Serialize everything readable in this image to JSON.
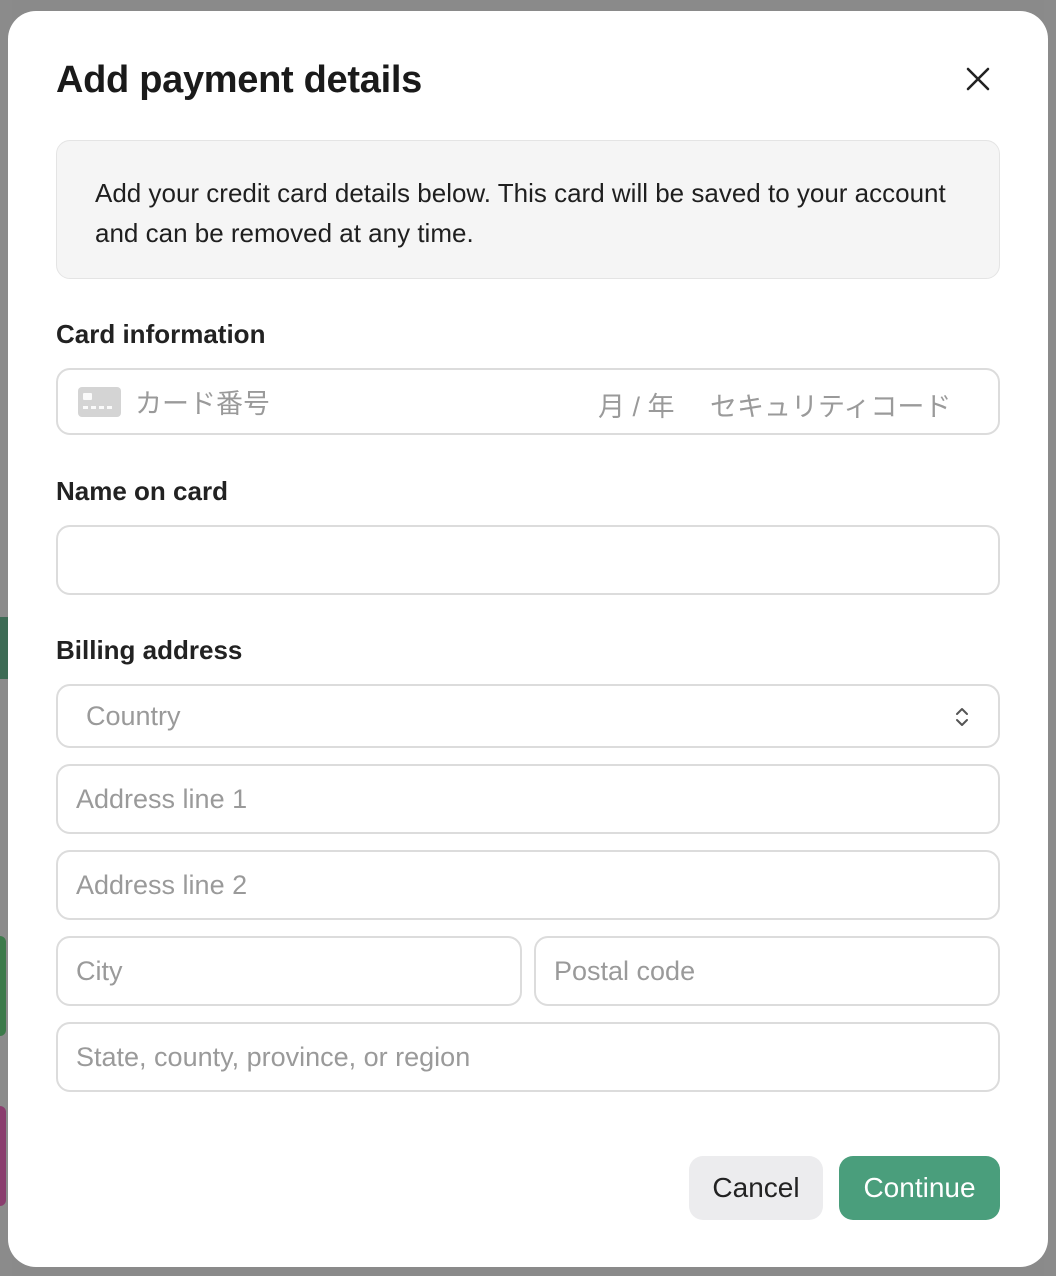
{
  "modal": {
    "title": "Add payment details",
    "info_text": "Add your credit card details below. This card will be saved to your account and can be removed at any time."
  },
  "card_information": {
    "label": "Card information",
    "number_placeholder": "カード番号",
    "expiry_placeholder": "月 / 年",
    "cvc_placeholder": "セキュリティコード"
  },
  "name_on_card": {
    "label": "Name on card",
    "value": ""
  },
  "billing_address": {
    "label": "Billing address",
    "country_placeholder": "Country",
    "address_line1_placeholder": "Address line 1",
    "address_line2_placeholder": "Address line 2",
    "city_placeholder": "City",
    "postal_code_placeholder": "Postal code",
    "state_placeholder": "State, county, province, or region"
  },
  "actions": {
    "cancel_label": "Cancel",
    "continue_label": "Continue"
  },
  "colors": {
    "accent": "#4a9e7c",
    "overlay": "#8b8b8b"
  },
  "icons": {
    "close": "close-icon",
    "card": "credit-card-icon",
    "select": "chevron-up-down-icon"
  }
}
